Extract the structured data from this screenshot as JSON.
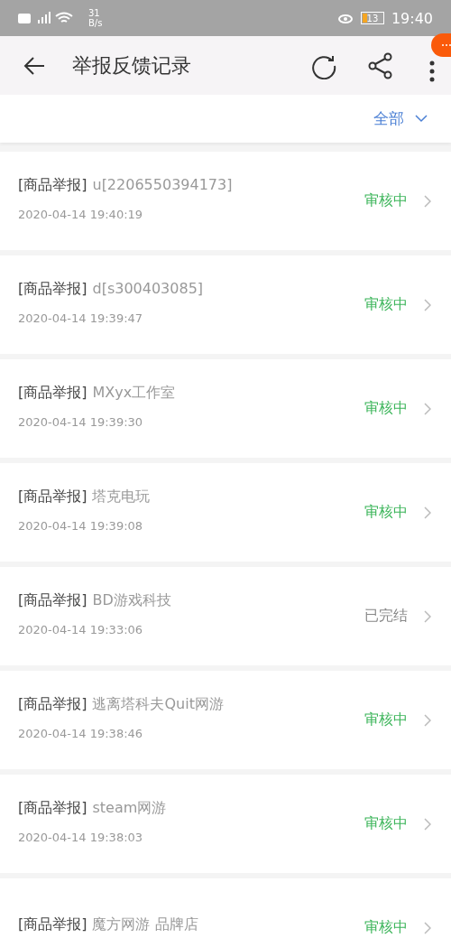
{
  "status_bar": {
    "speed": "31",
    "speed_unit": "B/s",
    "battery": "13",
    "time": "19:40"
  },
  "header": {
    "title": "举报反馈记录"
  },
  "filter": {
    "label": "全部"
  },
  "records": [
    {
      "tag": "[商品举报]",
      "name": "u[2206550394173]",
      "time": "2020-04-14 19:40:19",
      "status": "审核中",
      "completed": false
    },
    {
      "tag": "[商品举报]",
      "name": "d[s300403085]",
      "time": "2020-04-14 19:39:47",
      "status": "审核中",
      "completed": false
    },
    {
      "tag": "[商品举报]",
      "name": "MXyx工作室",
      "time": "2020-04-14 19:39:30",
      "status": "审核中",
      "completed": false
    },
    {
      "tag": "[商品举报]",
      "name": "塔克电玩",
      "time": "2020-04-14 19:39:08",
      "status": "审核中",
      "completed": false
    },
    {
      "tag": "[商品举报]",
      "name": "BD游戏科技",
      "time": "2020-04-14 19:33:06",
      "status": "已完结",
      "completed": true
    },
    {
      "tag": "[商品举报]",
      "name": "逃离塔科夫Quit网游",
      "time": "2020-04-14 19:38:46",
      "status": "审核中",
      "completed": false
    },
    {
      "tag": "[商品举报]",
      "name": "steam网游",
      "time": "2020-04-14 19:38:03",
      "status": "审核中",
      "completed": false
    },
    {
      "tag": "[商品举报]",
      "name": "魔方网游 品牌店",
      "status": "审核中",
      "completed": false
    }
  ]
}
